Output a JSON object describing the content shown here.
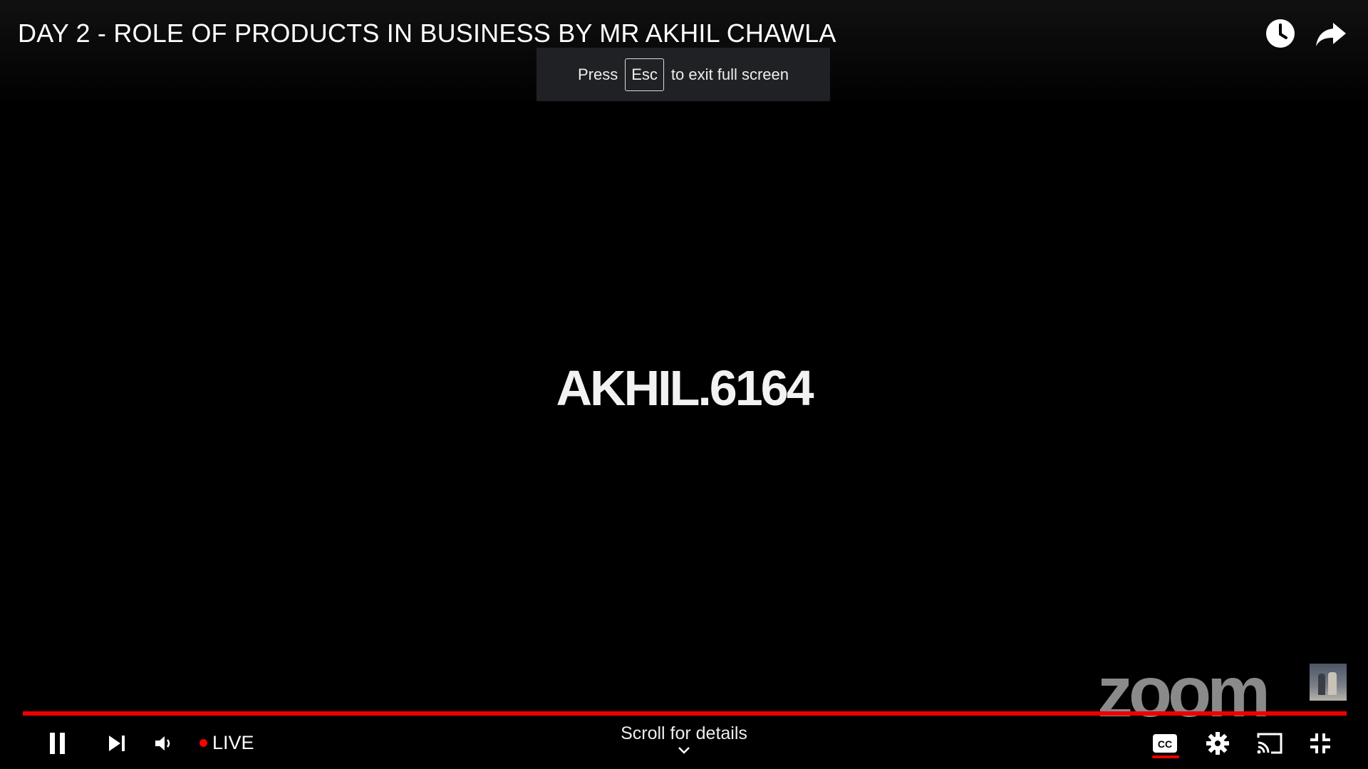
{
  "player": {
    "title": "DAY 2 - ROLE OF PRODUCTS IN BUSINESS BY MR AKHIL CHAWLA",
    "watermark": "AKHIL.6164",
    "zoom_logo": "zoom",
    "progress": 1.0
  },
  "toast": {
    "prefix": "Press",
    "key": "Esc",
    "suffix": "to exit full screen"
  },
  "controls": {
    "live_label": "LIVE",
    "scroll_label": "Scroll for details"
  },
  "icons": {
    "watch_later": "clock-icon",
    "share": "share-arrow-icon",
    "pause": "pause-icon",
    "next": "skip-next-icon",
    "volume": "volume-icon",
    "captions": "cc-icon",
    "settings": "gear-icon",
    "cast": "cast-icon",
    "exit_fullscreen": "exit-fullscreen-icon"
  },
  "colors": {
    "accent": "#e00000",
    "toast_bg": "#202124"
  }
}
